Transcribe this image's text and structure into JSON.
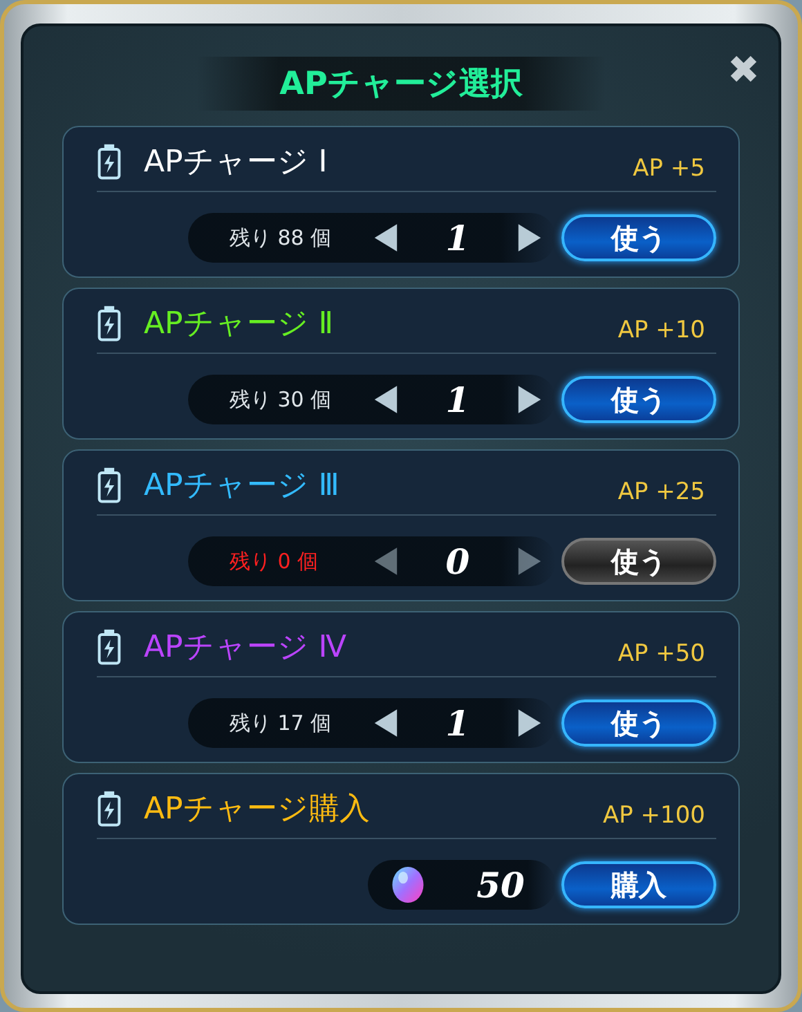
{
  "window": {
    "title": "APチャージ選択",
    "close": "✖"
  },
  "items": [
    {
      "kind": "use",
      "name": "APチャージ Ⅰ",
      "color": "#ffffff",
      "bonus": "AP +5",
      "remaining": "残り 88 個",
      "quantity": "1",
      "button": "使う",
      "disabled": false
    },
    {
      "kind": "use",
      "name": "APチャージ Ⅱ",
      "color": "#66ee22",
      "bonus": "AP +10",
      "remaining": "残り 30 個",
      "quantity": "1",
      "button": "使う",
      "disabled": false
    },
    {
      "kind": "use",
      "name": "APチャージ Ⅲ",
      "color": "#33bbff",
      "bonus": "AP +25",
      "remaining": "残り 0 個",
      "quantity": "0",
      "button": "使う",
      "disabled": true
    },
    {
      "kind": "use",
      "name": "APチャージ Ⅳ",
      "color": "#bb44ff",
      "bonus": "AP +50",
      "remaining": "残り 17 個",
      "quantity": "1",
      "button": "使う",
      "disabled": false
    },
    {
      "kind": "purchase",
      "name": "APチャージ購入",
      "color": "#ffbb11",
      "bonus": "AP +100",
      "price": "50",
      "button": "購入",
      "disabled": false
    }
  ]
}
